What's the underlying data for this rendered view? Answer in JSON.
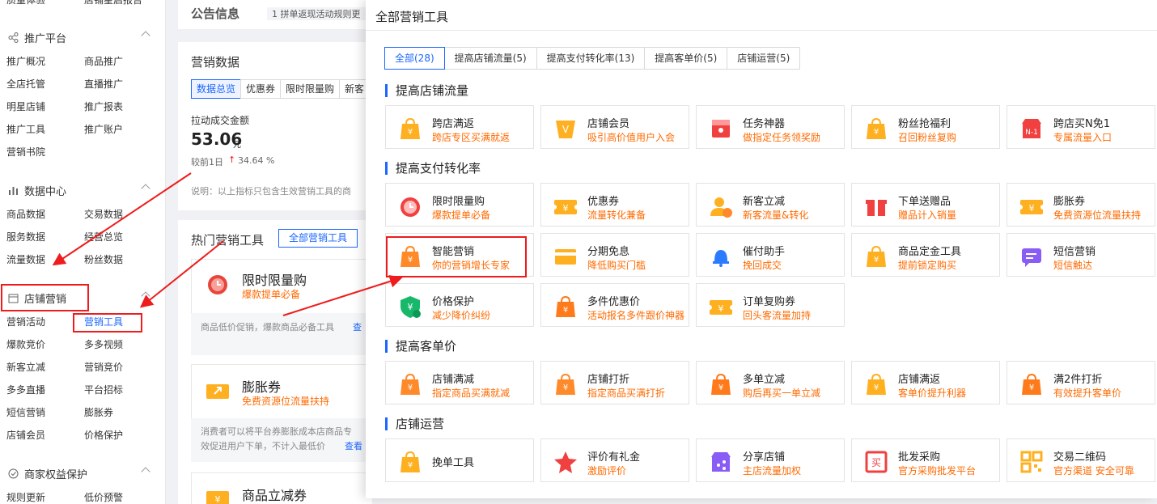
{
  "sidebar": {
    "top_items": [
      "质量体验",
      "店铺星启报告"
    ],
    "sections": [
      {
        "title": "推广平台",
        "items": [
          "推广概况",
          "商品推广",
          "全店托管",
          "直播推广",
          "明星店铺",
          "推广报表",
          "推广工具",
          "推广账户",
          "营销书院"
        ]
      },
      {
        "title": "数据中心",
        "items": [
          "商品数据",
          "交易数据",
          "服务数据",
          "经营总览",
          "流量数据",
          "粉丝数据"
        ]
      },
      {
        "title": "店铺营销",
        "items": [
          "营销活动",
          "营销工具",
          "爆款竞价",
          "多多视频",
          "新客立减",
          "营销竞价",
          "多多直播",
          "平台招标",
          "短信营销",
          "膨胀券",
          "店铺会员",
          "价格保护"
        ]
      },
      {
        "title": "商家权益保护",
        "items": [
          "规则更新",
          "低价预警"
        ]
      }
    ]
  },
  "main": {
    "notice_title": "公告信息",
    "notice_text": "1  拼单返现活动规则更",
    "marketing_title": "营销数据",
    "data_tabs": [
      "数据总览",
      "优惠券",
      "限时限量购",
      "新客"
    ],
    "metric_label": "拉动成交金额",
    "metric_value": "53.06",
    "metric_unit": "元",
    "compare_label": "较前1日",
    "compare_value": "34.64 %",
    "note": "说明：以上指标只包含生效营销工具的商",
    "hot_title": "热门营销工具",
    "all_tools_btn": "全部营销工具",
    "hot_cards": [
      {
        "name": "限时限量购",
        "desc": "爆款提单必备",
        "body": "商品低价促销，爆款商品必备工具",
        "link": "查"
      },
      {
        "name": "膨胀券",
        "desc": "免费资源位流量扶持",
        "body": "消费者可以将平台券膨胀成本店商品专",
        "body2": "效促进用户下单，不计入最低价",
        "link": "查看"
      },
      {
        "name": "商品立减券",
        "desc": "",
        "body": "",
        "link": ""
      }
    ]
  },
  "modal": {
    "title": "全部营销工具",
    "tabs": [
      "全部(28)",
      "提高店铺流量(5)",
      "提高支付转化率(13)",
      "提高客单价(5)",
      "店铺运营(5)"
    ],
    "categories": [
      {
        "title": "提高店铺流量",
        "tools": [
          {
            "name": "跨店满返",
            "desc": "跨店专区买满就返",
            "icon": "coin-bag-icon",
            "color": "#ffb020"
          },
          {
            "name": "店铺会员",
            "desc": "吸引高价值用户入会",
            "icon": "vip-badge-icon",
            "color": "#ffb020"
          },
          {
            "name": "任务神器",
            "desc": "做指定任务领奖励",
            "icon": "task-box-icon",
            "color": "#f04040"
          },
          {
            "name": "粉丝抢福利",
            "desc": "召回粉丝复购",
            "icon": "gift-envelope-icon",
            "color": "#ffb020"
          },
          {
            "name": "跨店买N免1",
            "desc": "专属流量入口",
            "icon": "shop-n1-icon",
            "color": "#f04040"
          }
        ]
      },
      {
        "title": "提高支付转化率",
        "tools": [
          {
            "name": "限时限量购",
            "desc": "爆款提单必备",
            "icon": "alarm-clock-icon",
            "color": "#f04040"
          },
          {
            "name": "优惠券",
            "desc": "流量转化兼备",
            "icon": "coupon-icon",
            "color": "#ffb020"
          },
          {
            "name": "新客立减",
            "desc": "新客流量&转化",
            "icon": "new-user-icon",
            "color": "#ffb020"
          },
          {
            "name": "下单送赠品",
            "desc": "赠品计入销量",
            "icon": "gift-box-icon",
            "color": "#f04040"
          },
          {
            "name": "膨胀券",
            "desc": "免费资源位流量扶持",
            "icon": "expand-coupon-icon",
            "color": "#ffb020"
          },
          {
            "name": "智能营销",
            "desc": "你的营销增长专家",
            "icon": "smart-bag-icon",
            "color": "#ff8a2a"
          },
          {
            "name": "分期免息",
            "desc": "降低购买门槛",
            "icon": "card-icon",
            "color": "#ffb020"
          },
          {
            "name": "催付助手",
            "desc": "挽回成交",
            "icon": "bell-icon",
            "color": "#2b7bff"
          },
          {
            "name": "商品定金工具",
            "desc": "提前锁定购买",
            "icon": "deposit-bag-icon",
            "color": "#ffb020"
          },
          {
            "name": "短信营销",
            "desc": "短信触达",
            "icon": "sms-icon",
            "color": "#8a5cf6"
          },
          {
            "name": "价格保护",
            "desc": "减少降价纠纷",
            "icon": "shield-icon",
            "color": "#18b86b"
          },
          {
            "name": "多件优惠价",
            "desc": "活动报名多件跟价神器",
            "icon": "multi-bag-icon",
            "color": "#ff7a1a"
          },
          {
            "name": "订单复购券",
            "desc": "回头客流量加持",
            "icon": "repurchase-coupon-icon",
            "color": "#ffb020"
          }
        ]
      },
      {
        "title": "提高客单价",
        "tools": [
          {
            "name": "店铺满减",
            "desc": "指定商品买满就减",
            "icon": "shop-discount-icon",
            "color": "#ff8a2a"
          },
          {
            "name": "店铺打折",
            "desc": "指定商品买满打折",
            "icon": "shop-percent-icon",
            "color": "#ff8a2a"
          },
          {
            "name": "多单立减",
            "desc": "购后再买一单立减",
            "icon": "multi-order-icon",
            "color": "#ff7a1a"
          },
          {
            "name": "店铺满返",
            "desc": "客单价提升利器",
            "icon": "cashback-icon",
            "color": "#ffb020"
          },
          {
            "name": "满2件打折",
            "desc": "有效提升客单价",
            "icon": "bag-percent-icon",
            "color": "#ff7a1a"
          }
        ]
      },
      {
        "title": "店铺运营",
        "tools": [
          {
            "name": "挽单工具",
            "desc": "",
            "icon": "recover-order-icon",
            "color": "#ffb020"
          },
          {
            "name": "评价有礼金",
            "desc": "激励评价",
            "icon": "review-star-icon",
            "color": "#f04040"
          },
          {
            "name": "分享店铺",
            "desc": "主店流量加权",
            "icon": "share-shop-icon",
            "color": "#8a5cf6"
          },
          {
            "name": "批发采购",
            "desc": "官方采购批发平台",
            "icon": "wholesale-icon",
            "color": "#f04040"
          },
          {
            "name": "交易二维码",
            "desc": "官方渠道 安全可靠",
            "icon": "qrcode-icon",
            "color": "#ffb020"
          }
        ]
      }
    ]
  }
}
